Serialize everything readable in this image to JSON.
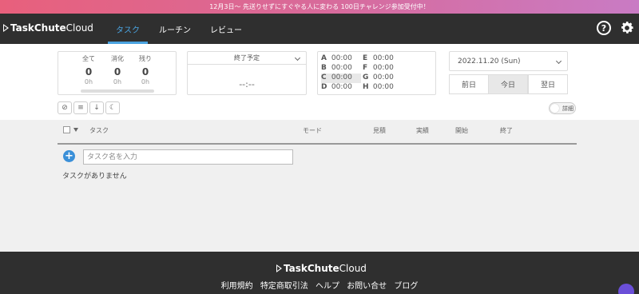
{
  "banner": {
    "text": "12月3日〜 先送りせずにすぐやる人に変わる 100日チャレンジ参加受付中！"
  },
  "header": {
    "logo_bold": "TaskChute",
    "logo_light": "Cloud",
    "tabs": [
      {
        "label": "タスク",
        "active": true
      },
      {
        "label": "ルーチン",
        "active": false
      },
      {
        "label": "レビュー",
        "active": false
      }
    ],
    "help_icon": "?"
  },
  "stats": {
    "columns": [
      {
        "label": "全て",
        "count": "0",
        "hours": "0h"
      },
      {
        "label": "消化",
        "count": "0",
        "hours": "0h"
      },
      {
        "label": "残り",
        "count": "0",
        "hours": "0h"
      }
    ],
    "progress": 0
  },
  "end_time": {
    "label": "終了予定",
    "value": "--:--"
  },
  "sections": [
    {
      "key": "A",
      "time": "00:00"
    },
    {
      "key": "B",
      "time": "00:00"
    },
    {
      "key": "C",
      "time": "00:00",
      "highlight": true
    },
    {
      "key": "D",
      "time": "00:00"
    },
    {
      "key": "E",
      "time": "00:00"
    },
    {
      "key": "F",
      "time": "00:00"
    },
    {
      "key": "G",
      "time": "00:00"
    },
    {
      "key": "H",
      "time": "00:00"
    }
  ],
  "date": {
    "selected": "2022.11.20 (Sun)",
    "prev": "前日",
    "today": "今日",
    "next": "翌日"
  },
  "toggle": {
    "label": "詳細"
  },
  "table": {
    "headers": {
      "task": "タスク",
      "mode": "モード",
      "estimate": "見積",
      "actual": "実績",
      "start": "開始",
      "end": "終了"
    },
    "input_placeholder": "タスク名を入力",
    "empty_message": "タスクがありません"
  },
  "footer": {
    "logo_bold": "TaskChute",
    "logo_light": "Cloud",
    "links": [
      "利用規約",
      "特定商取引法",
      "ヘルプ",
      "お問い合せ",
      "ブログ"
    ]
  },
  "colors": {
    "accent": "#4aa3e0",
    "header_bg": "#2f2f2f",
    "add_button": "#3a8fd8"
  }
}
